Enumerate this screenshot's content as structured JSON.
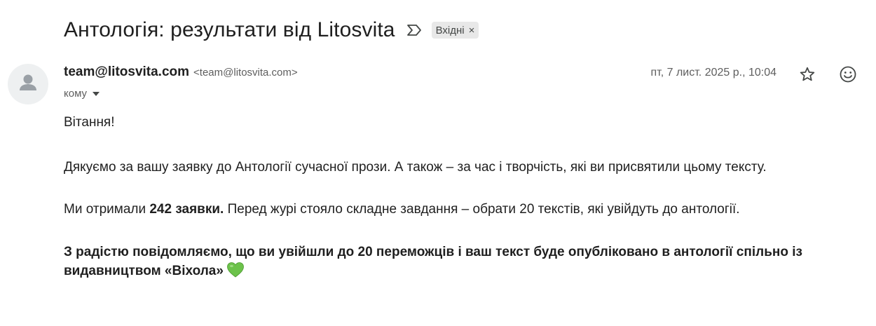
{
  "email": {
    "subject": "Антологія: результати від Litosvita",
    "label": "Вхідні",
    "label_remove": "×",
    "sender_name": "team@litosvita.com",
    "sender_email": "<team@litosvita.com>",
    "to_label": "кому",
    "date": "пт, 7 лист. 2025 р., 10:04"
  },
  "icons": {
    "important": "important-marker-icon",
    "star": "star-icon",
    "emoji": "add-reaction-icon",
    "avatar": "default-avatar-icon",
    "heart": "green-heart-emoji"
  },
  "body": {
    "greeting": "Вітання!",
    "thanks": "Дякуємо за вашу заявку до Антології сучасної прози. А також – за час і творчість, які ви присвятили цьому тексту.",
    "received_prefix": "Ми отримали ",
    "received_count": "242 заявки.",
    "received_suffix": " Перед журі стояло складне завдання – обрати 20 текстів, які увійдуть до антології.",
    "result": "З радістю повідомляємо, що ви увійшли до 20 переможців і ваш текст буде опубліковано в антології спільно із видавництвом «Віхола»"
  },
  "colors": {
    "heart": "#6cc24a",
    "label_bg": "#e8e8e8",
    "avatar_bg": "#eef0f1"
  }
}
